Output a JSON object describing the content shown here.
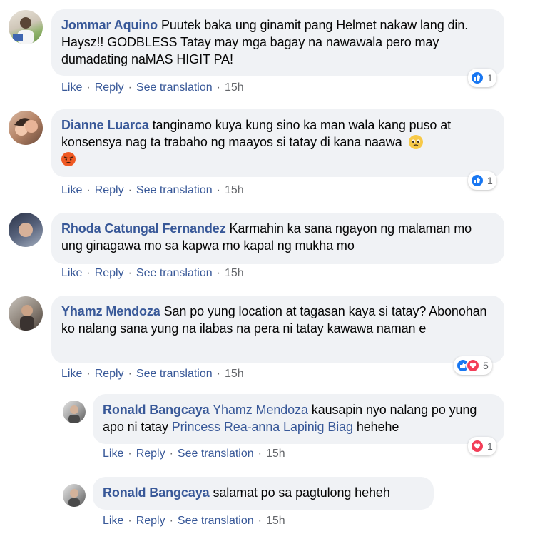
{
  "comments": [
    {
      "author": "Jommar Aquino",
      "text": " Puutek baka ung ginamit pang Helmet nakaw lang din. Haysz!! GODBLESS Tatay may mga bagay na nawawala pero may dumadating naMAS HIGIT PA!",
      "reaction_count": "1",
      "actions": {
        "like": "Like",
        "reply": "Reply",
        "translate": "See translation",
        "time": "15h"
      }
    },
    {
      "author": "Dianne Luarca",
      "text": " tanginamo kuya kung sino ka man wala kang puso at konsensya nag ta trabaho ng maayos si tatay di kana naawa",
      "emojis": [
        "pleading-face-emoji",
        "angry-face-emoji"
      ],
      "reaction_count": "1",
      "actions": {
        "like": "Like",
        "reply": "Reply",
        "translate": "See translation",
        "time": "15h"
      }
    },
    {
      "author": "Rhoda Catungal Fernandez",
      "text": " Karmahin ka sana ngayon ng malaman mo ung ginagawa mo sa kapwa mo kapal ng mukha mo",
      "actions": {
        "like": "Like",
        "reply": "Reply",
        "translate": "See translation",
        "time": "15h"
      }
    },
    {
      "author": "Yhamz Mendoza",
      "text": " San po yung location at tagasan kaya si tatay? Abonohan ko nalang sana yung na ilabas na pera ni tatay kawawa naman e",
      "reaction_count": "5",
      "actions": {
        "like": "Like",
        "reply": "Reply",
        "translate": "See translation",
        "time": "15h"
      }
    }
  ],
  "replies": [
    {
      "author": "Ronald Bangcaya",
      "mention1": "Yhamz Mendoza",
      "text1": " kausapin nyo nalang po yung apo ni tatay ",
      "mention2": "Princess Rea-anna Lapinig Biag",
      "text2": " hehehe",
      "reaction_count": "1",
      "actions": {
        "like": "Like",
        "reply": "Reply",
        "translate": "See translation",
        "time": "15h"
      }
    },
    {
      "author": "Ronald Bangcaya",
      "text": " salamat po sa pagtulong heheh",
      "actions": {
        "like": "Like",
        "reply": "Reply",
        "translate": "See translation",
        "time": "15h"
      }
    }
  ],
  "colors": {
    "link": "#385898",
    "bubble": "#f0f2f5",
    "like": "#1877f2",
    "love": "#f33e58",
    "meta": "#65676b"
  }
}
